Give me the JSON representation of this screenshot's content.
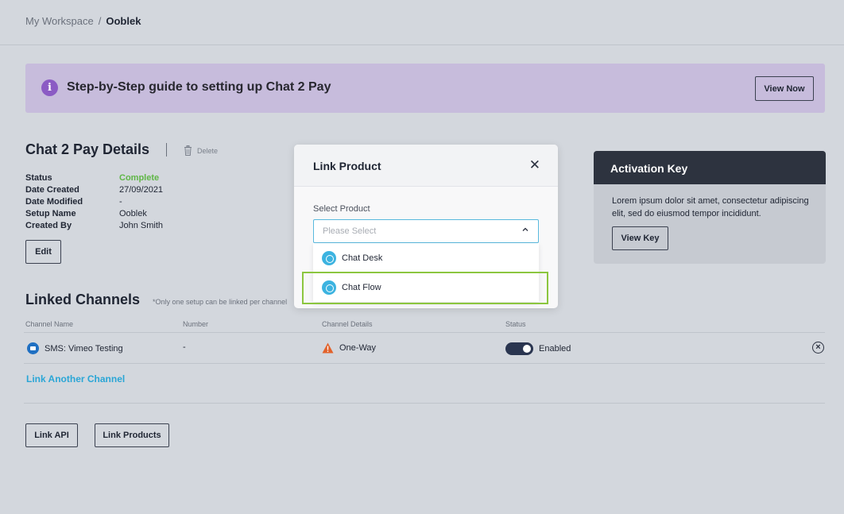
{
  "breadcrumb": {
    "root": "My Workspace",
    "separator": "/",
    "current": "Ooblek"
  },
  "banner": {
    "icon": "info-icon",
    "title": "Step-by-Step guide to setting up Chat 2 Pay",
    "button": "View Now"
  },
  "details": {
    "title": "Chat 2 Pay Details",
    "delete_label": "Delete",
    "rows": [
      {
        "key": "Status",
        "value": "Complete"
      },
      {
        "key": "Date Created",
        "value": "27/09/2021"
      },
      {
        "key": "Date Modified",
        "value": "-"
      },
      {
        "key": "Setup Name",
        "value": "Ooblek"
      },
      {
        "key": "Created By",
        "value": "John Smith"
      }
    ],
    "edit_button": "Edit"
  },
  "linked": {
    "title": "Linked Channels",
    "note": "*Only one setup can be linked per channel",
    "columns": [
      "Channel Name",
      "Number",
      "Channel Details",
      "Status"
    ],
    "row": {
      "channel": "SMS: Vimeo Testing",
      "number": "-",
      "details": "One-Way",
      "status": "Enabled",
      "enabled": true
    },
    "link_another": "Link Another Channel"
  },
  "buttons": {
    "link_api": "Link API",
    "link_products": "Link Products"
  },
  "activation": {
    "title": "Activation Key",
    "body": "Lorem ipsum dolor sit amet, consectetur adipiscing elit, sed do eiusmod tempor incididunt.",
    "button": "View Key"
  },
  "modal": {
    "title": "Link Product",
    "label": "Select Product",
    "placeholder": "Please Select",
    "options": [
      "Chat Desk",
      "Chat Flow"
    ],
    "highlighted_option": "Chat Flow"
  },
  "colors": {
    "accent": "#2aa6d6",
    "success": "#5fb646",
    "highlight": "#8cc63f",
    "banner": "#c7bcdc",
    "header_dark": "#2d333f"
  }
}
